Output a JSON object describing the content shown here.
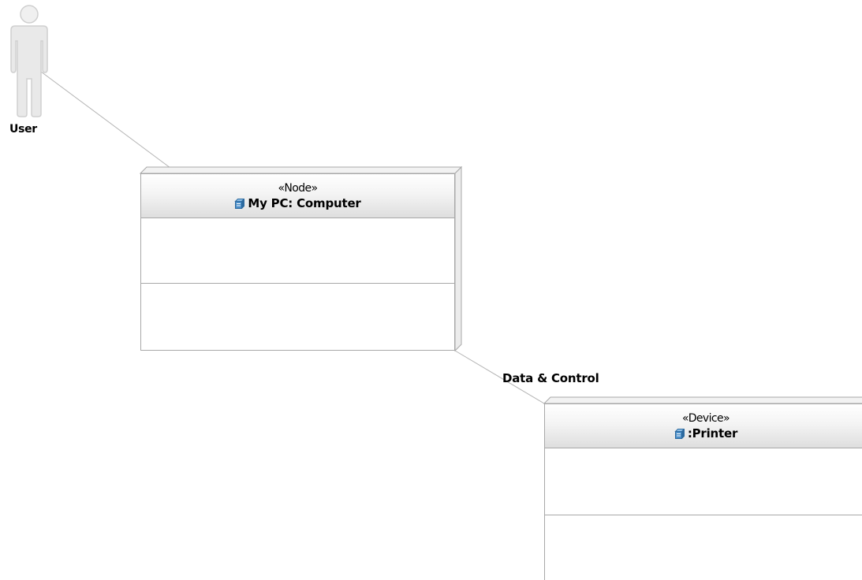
{
  "actor": {
    "label": "User",
    "icon": "actor-stick-figure-icon"
  },
  "nodes": [
    {
      "stereotype": "«Node»",
      "name": "My PC: Computer",
      "icon": "node-cube-icon"
    },
    {
      "stereotype": "«Device»",
      "name": ":Printer",
      "icon": "node-cube-icon"
    }
  ],
  "connectors": [
    {
      "label": "Data & Control"
    }
  ],
  "colors": {
    "outline": "#a8a8a8",
    "header_top": "#ffffff",
    "header_bottom": "#dedede",
    "actor_fill": "#e6e6e6",
    "icon_blue": "#4a8ec9"
  }
}
